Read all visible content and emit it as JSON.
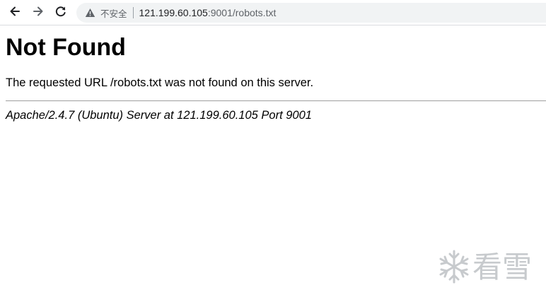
{
  "browser": {
    "security_label": "不安全",
    "url_host": "121.199.60.105",
    "url_path": ":9001/robots.txt",
    "icons": {
      "back": "arrow-left-icon",
      "forward": "arrow-right-icon",
      "reload": "reload-icon",
      "security": "warning-triangle-icon"
    }
  },
  "page": {
    "heading": "Not Found",
    "message": "The requested URL /robots.txt was not found on this server.",
    "server_signature": "Apache/2.4.7 (Ubuntu) Server at 121.199.60.105 Port 9001"
  },
  "watermark": {
    "text": "看雪",
    "icon": "snowflake-icon"
  }
}
